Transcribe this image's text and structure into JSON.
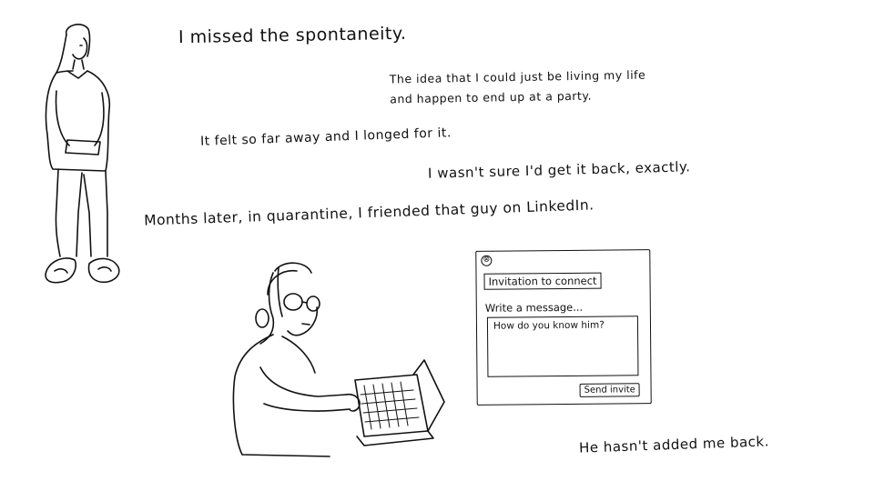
{
  "captions": {
    "line1": "I missed the spontaneity.",
    "line2a": "The idea that I could just be living my life",
    "line2b": "and happen to end up at a party.",
    "line3": "It felt so far away and I longed for it.",
    "line4": "I wasn't sure I'd get it back, exactly.",
    "line5": "Months later, in quarantine, I friended that guy on LinkedIn.",
    "line6": "He hasn't added me back."
  },
  "dialog": {
    "close_glyph": "⊗",
    "title": "Invitation to connect",
    "prompt": "Write a message...",
    "message": "How do you know him?",
    "send_label": "Send invite"
  },
  "icons": [
    "close-circle-icon"
  ],
  "colors": {
    "ink": "#111111",
    "paper": "#ffffff"
  }
}
